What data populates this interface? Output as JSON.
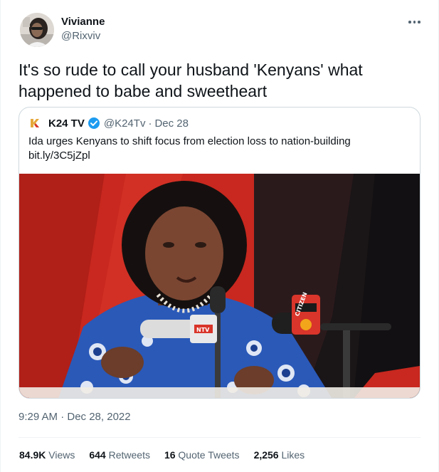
{
  "author": {
    "name": "Vivianne",
    "handle": "@Rixviv"
  },
  "tweet": {
    "text": "It's so rude to call your husband 'Kenyans' what happened to babe and sweetheart",
    "timestamp": "9:29 AM · Dec 28, 2022"
  },
  "quoted": {
    "name": "K24 TV",
    "handle": "@K24Tv",
    "separator": "·",
    "date": "Dec 28",
    "text_line1": "Ida urges Kenyans to shift focus from election loss to nation-building",
    "text_line2": "bit.ly/3C5jZpl",
    "mic_label": "CITIZEN",
    "mic_label2": "NTV"
  },
  "stats": {
    "views_count": "84.9K",
    "views_label": "Views",
    "retweets_count": "644",
    "retweets_label": "Retweets",
    "quotes_count": "16",
    "quotes_label": "Quote Tweets",
    "likes_count": "2,256",
    "likes_label": "Likes"
  },
  "icons": {
    "more": "more-dots-icon",
    "verified": "verified-badge-icon",
    "k24_logo": "k24-logo-icon"
  },
  "colors": {
    "text": "#0f1419",
    "secondary": "#536471",
    "verified": "#1d9bf0",
    "border": "#cfd9de"
  }
}
